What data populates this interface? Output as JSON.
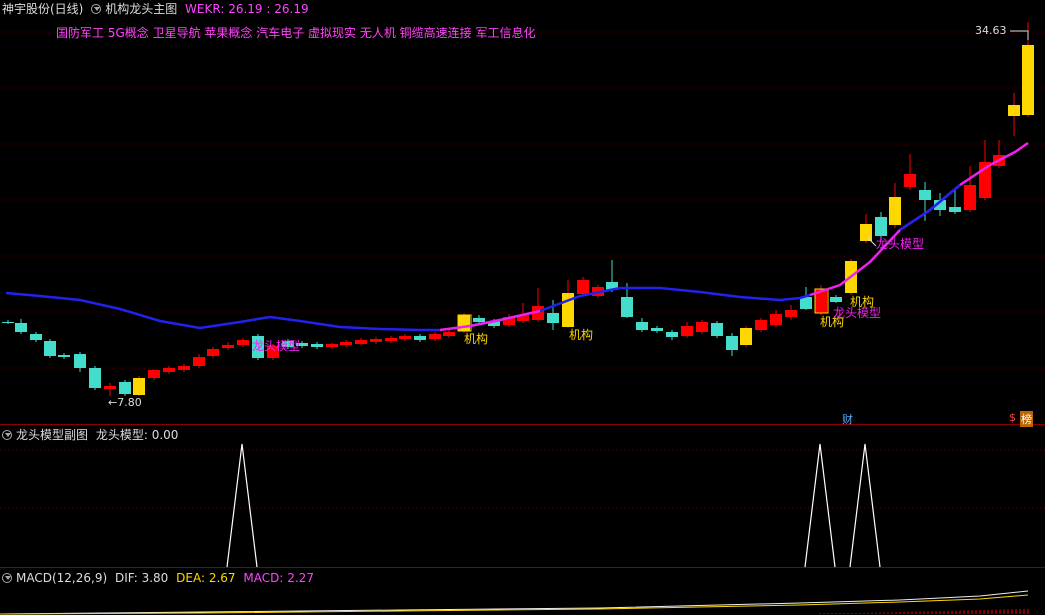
{
  "main_panel": {
    "stock_name": "神宇股份(日线)",
    "indicator_name": "机构龙头主图",
    "wekr_label": "WEKR:",
    "wekr_values": "26.19 : 26.19",
    "concepts": "国防军工 5G概念 卫星导航 苹果概念 汽车电子 虚拟现实 无人机 铜缆高速连接 军工信息化",
    "high_label": "34.63",
    "low_label": "7.80",
    "marker_cai": "财",
    "marker_bang": "榜",
    "marker_s": "$"
  },
  "annotations": {
    "jigou": "机构",
    "longtou": "龙头模型"
  },
  "sub_panel": {
    "title": "龙头模型副图",
    "value_label": "龙头模型:",
    "value": "0.00"
  },
  "macd_panel": {
    "title": "MACD(12,26,9)",
    "dif_label": "DIF:",
    "dif_value": "3.80",
    "dea_label": "DEA:",
    "dea_value": "2.67",
    "macd_label": "MACD:",
    "macd_value": "2.27"
  },
  "colors": {
    "up": "#ff0000",
    "down": "#44ddcc",
    "highlight": "#ffd700",
    "ma_blue": "#2222ee",
    "ma_magenta": "#ee22ee",
    "grid": "#5a0000",
    "concept_text": "#ff44ff"
  },
  "chart_data": {
    "type": "candlestick",
    "high": 34.63,
    "low": 7.8,
    "series": [],
    "signals": {
      "jigou": [
        12,
        22,
        39,
        40
      ],
      "longtou": [
        9,
        40,
        43
      ]
    }
  }
}
